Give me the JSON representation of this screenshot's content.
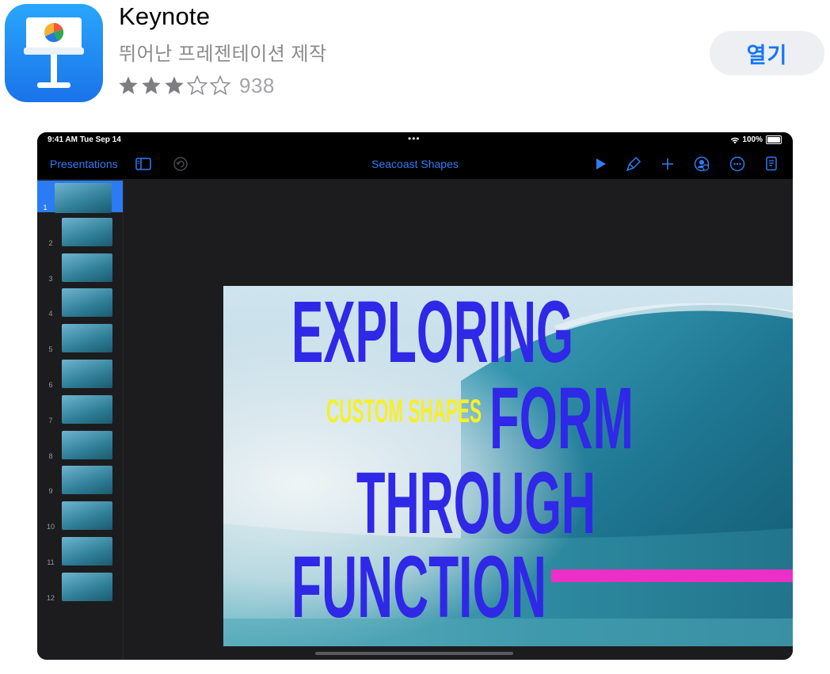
{
  "app": {
    "name": "Keynote",
    "subtitle": "뛰어난 프레젠테이션 제작",
    "rating_stars": 3,
    "rating_max": 5,
    "rating_count": "938",
    "open_label": "열기"
  },
  "ipad": {
    "status": {
      "time": "9:41 AM   Tue Sep 14",
      "dots": "•••",
      "battery": "100%"
    },
    "toolbar": {
      "back": "Presentations",
      "title": "Seacoast Shapes"
    },
    "slides": [
      "1",
      "2",
      "3",
      "4",
      "5",
      "6",
      "7",
      "8",
      "9",
      "10",
      "11",
      "12"
    ],
    "selected_slide": 1,
    "slide": {
      "line1": "EXPLORING",
      "line2": "FORM",
      "line3": "THROUGH",
      "line4": "FUNCTION",
      "tag": "CUSTOM SHAPES"
    },
    "colors": {
      "title": "#2f28e6",
      "tag": "#f6ef2a",
      "accent_bar": "#ec2fc6",
      "link": "#2f7cf6"
    }
  }
}
